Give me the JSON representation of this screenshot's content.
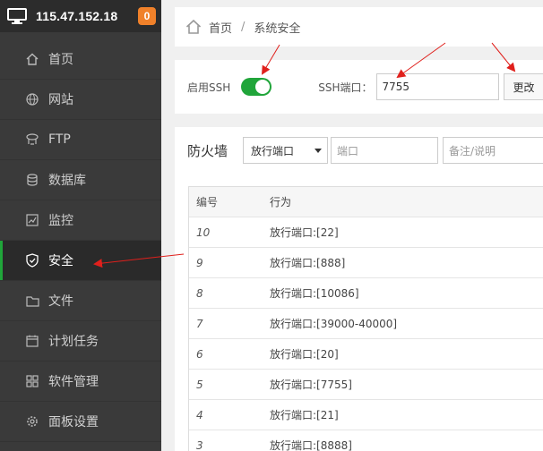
{
  "server": {
    "ip": "115.47.152.18",
    "notification_count": "0"
  },
  "sidebar": {
    "items": [
      {
        "label": "首页",
        "icon": "home-icon",
        "active": false
      },
      {
        "label": "网站",
        "icon": "globe-icon",
        "active": false
      },
      {
        "label": "FTP",
        "icon": "ftp-icon",
        "active": false
      },
      {
        "label": "数据库",
        "icon": "database-icon",
        "active": false
      },
      {
        "label": "监控",
        "icon": "monitor-chart-icon",
        "active": false
      },
      {
        "label": "安全",
        "icon": "shield-icon",
        "active": true
      },
      {
        "label": "文件",
        "icon": "folder-icon",
        "active": false
      },
      {
        "label": "计划任务",
        "icon": "calendar-icon",
        "active": false
      },
      {
        "label": "软件管理",
        "icon": "apps-grid-icon",
        "active": false
      },
      {
        "label": "面板设置",
        "icon": "gear-icon",
        "active": false
      }
    ]
  },
  "breadcrumb": {
    "home": "首页",
    "separator": "/",
    "current": "系统安全"
  },
  "ssh": {
    "enable_label": "启用SSH",
    "enabled": true,
    "port_label": "SSH端口：",
    "port_value": "7755",
    "change_button": "更改"
  },
  "firewall": {
    "title": "防火墙",
    "action_select": "放行端口",
    "port_placeholder": "端口",
    "note_placeholder": "备注/说明",
    "columns": {
      "id": "编号",
      "action": "行为"
    },
    "rows": [
      {
        "id": "10",
        "action": "放行端口:[22]"
      },
      {
        "id": "9",
        "action": "放行端口:[888]"
      },
      {
        "id": "8",
        "action": "放行端口:[10086]"
      },
      {
        "id": "7",
        "action": "放行端口:[39000-40000]"
      },
      {
        "id": "6",
        "action": "放行端口:[20]"
      },
      {
        "id": "5",
        "action": "放行端口:[7755]"
      },
      {
        "id": "4",
        "action": "放行端口:[21]"
      },
      {
        "id": "3",
        "action": "放行端口:[8888]"
      }
    ]
  },
  "colors": {
    "sidebar_bg": "#3a3a3a",
    "accent_green": "#20a53a",
    "badge_orange": "#f0812a",
    "annotation_red": "#e0201c"
  }
}
